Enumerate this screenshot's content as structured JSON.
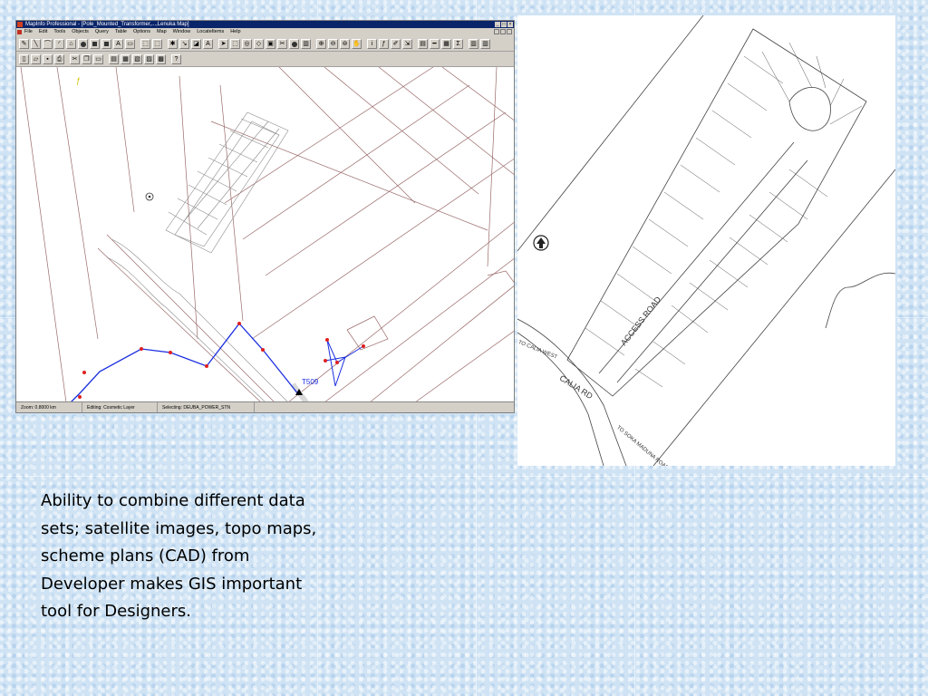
{
  "app": {
    "title": "MapInfo Professional - [Pole_Mounted_Transformer,...,Lenuka Map]",
    "menu": [
      "File",
      "Edit",
      "Tools",
      "Objects",
      "Query",
      "Table",
      "Options",
      "Map",
      "Window",
      "LocateItems",
      "Help"
    ],
    "status": {
      "zoom": "Zoom: 0.8000 km",
      "editing": "Editing: Cosmetic Layer",
      "selecting": "Selecting: DEUBA_POWER_STN"
    },
    "pole_label": "T509"
  },
  "plan": {
    "road_1": "CALIA RD",
    "road_2": "ACCESS ROAD",
    "road_3": "TO CALIA WEST",
    "road_4": "TO SOKA MADUNA ROAD"
  },
  "caption": "Ability to combine different data sets; satellite images, topo maps, scheme plans (CAD) from Developer makes GIS important tool for Designers.",
  "colors": {
    "background": "#cfe3f4",
    "line_blue": "#1a2ee0",
    "vertex_red": "#e02020",
    "parcel_brown": "#9a6a6a"
  }
}
